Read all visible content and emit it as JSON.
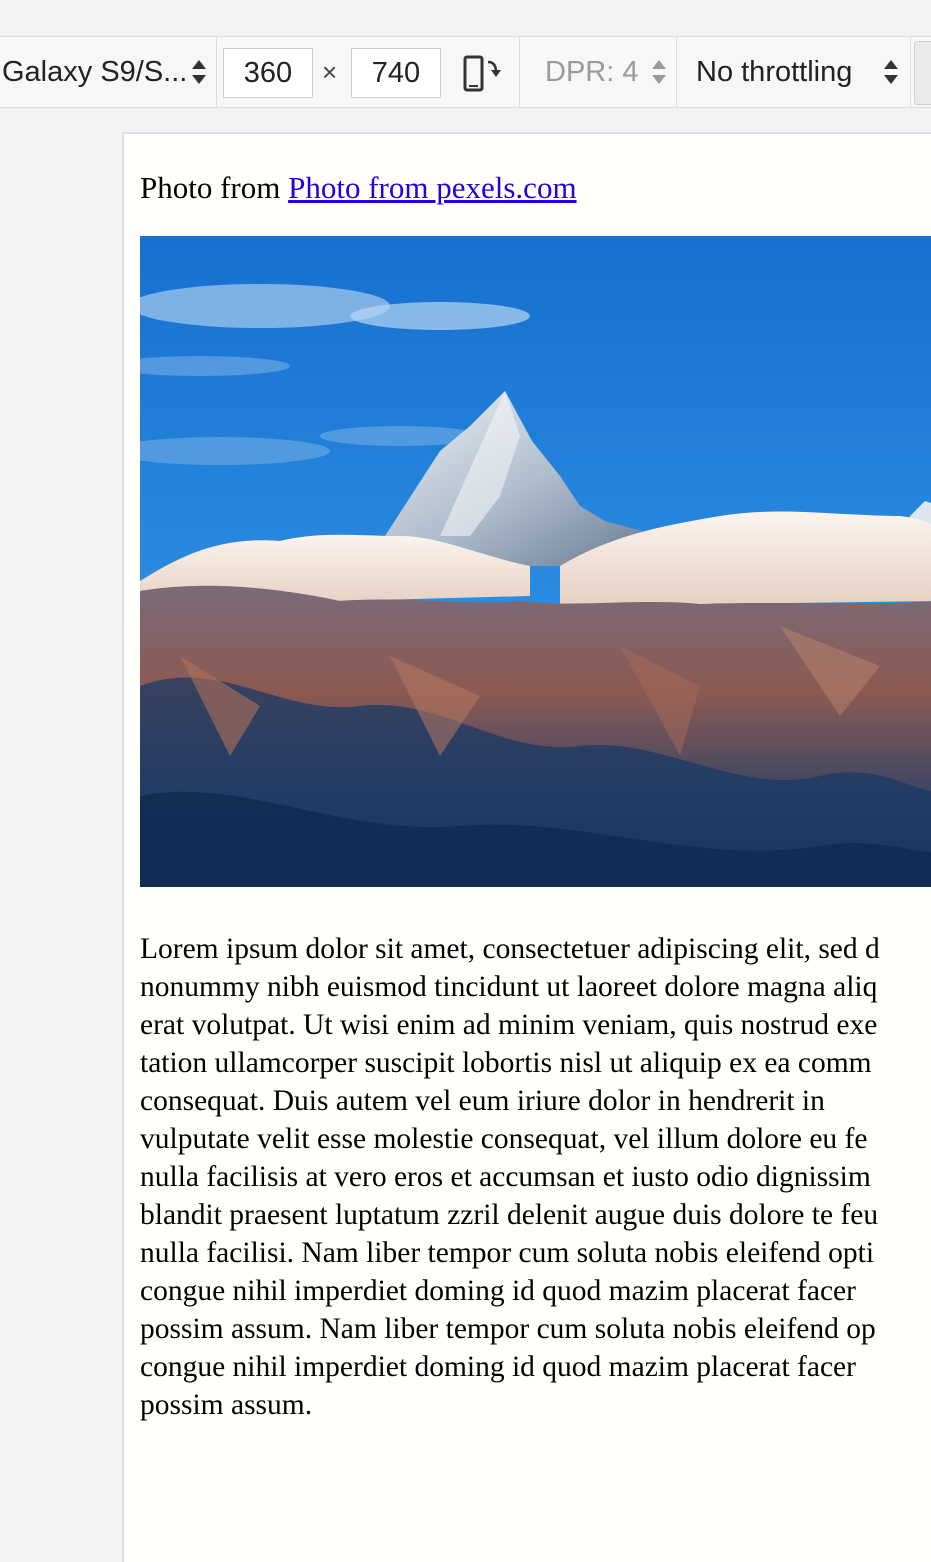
{
  "toolbar": {
    "device": "Galaxy S9/S...",
    "width": "360",
    "times": "×",
    "height": "740",
    "dpr": "DPR: 4",
    "throttling": "No throttling"
  },
  "page": {
    "credit_prefix": "Photo from",
    "credit_link": "Photo from pexels.com",
    "photo_subject": "mountain-peak-above-clouds",
    "colors": {
      "link": "#2200e0",
      "sky": "#1a78d4"
    },
    "lorem_lines": [
      "Lorem ipsum dolor sit amet, consectetuer adipiscing elit, sed d",
      "nonummy nibh euismod tincidunt ut laoreet dolore magna aliq",
      "erat volutpat. Ut wisi enim ad minim veniam, quis nostrud exe",
      "tation ullamcorper suscipit lobortis nisl ut aliquip ex ea comm",
      "consequat. Duis autem vel eum iriure dolor in hendrerit in",
      "vulputate velit esse molestie consequat, vel illum dolore eu fe",
      "nulla facilisis at vero eros et accumsan et iusto odio dignissim",
      "blandit praesent luptatum zzril delenit augue duis dolore te feu",
      "nulla facilisi. Nam liber tempor cum soluta nobis eleifend opti",
      "congue nihil imperdiet doming id quod mazim placerat facer",
      "possim assum. Nam liber tempor cum soluta nobis eleifend op",
      "congue nihil imperdiet doming id quod mazim placerat facer",
      "possim assum."
    ]
  }
}
